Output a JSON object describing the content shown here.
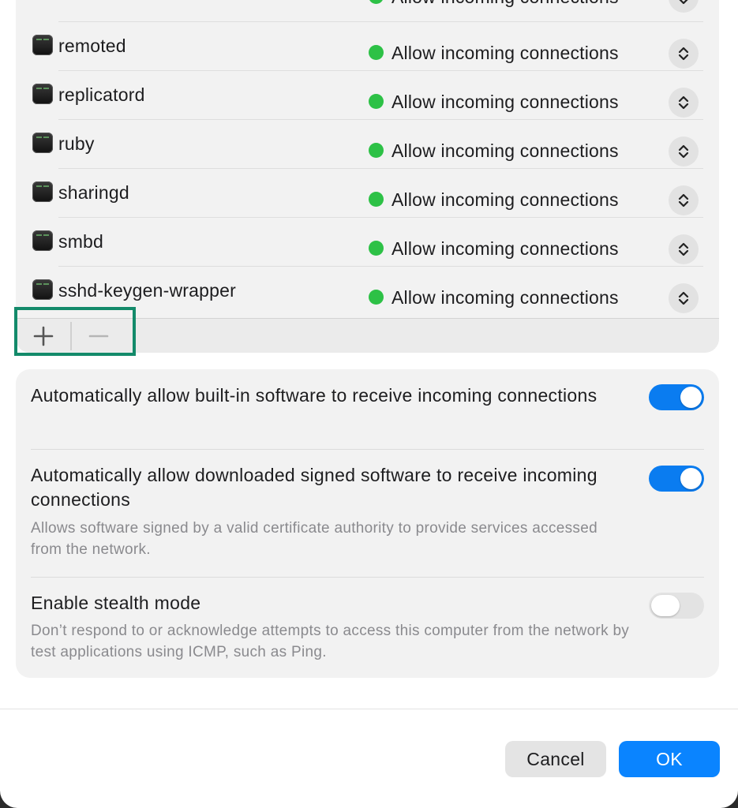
{
  "app_list": {
    "status_text": "Allow incoming connections",
    "status_color": "#2dc146",
    "partial_top_label": "Allow incoming connections",
    "items": [
      {
        "name": "remoted"
      },
      {
        "name": "replicatord"
      },
      {
        "name": "ruby"
      },
      {
        "name": "sharingd"
      },
      {
        "name": "smbd"
      },
      {
        "name": "sshd-keygen-wrapper"
      }
    ],
    "icons": {
      "app": "terminal-app-icon",
      "stepper": "chevron-up-down-icon",
      "add": "plus-icon",
      "remove": "minus-icon"
    }
  },
  "settings": {
    "builtin": {
      "title": "Automatically allow built-in software to receive incoming connections",
      "enabled": true
    },
    "signed": {
      "title": "Automatically allow downloaded signed software to receive incoming connections",
      "description": "Allows software signed by a valid certificate authority to provide services accessed from the network.",
      "enabled": true
    },
    "stealth": {
      "title": "Enable stealth mode",
      "description": "Don’t respond to or acknowledge attempts to access this computer from the network by test applications using ICMP, such as Ping.",
      "enabled": false
    }
  },
  "buttons": {
    "cancel": "Cancel",
    "ok": "OK"
  },
  "colors": {
    "accent": "#0a84ff",
    "toggle_on": "#0a7cf0",
    "highlight": "#138a6a"
  }
}
